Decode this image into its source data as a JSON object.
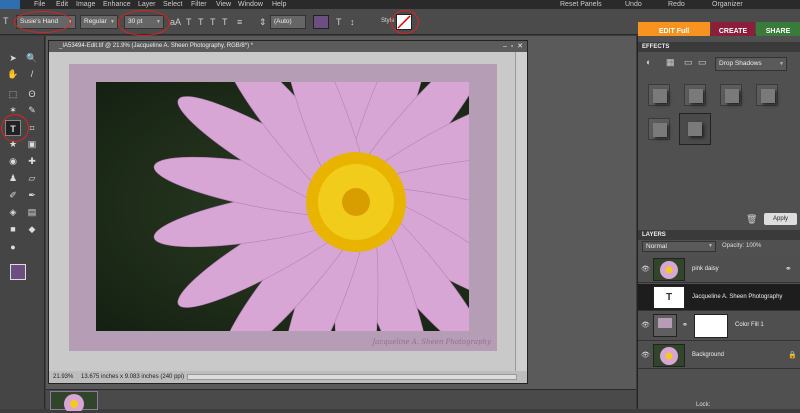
{
  "menubar": {
    "items": [
      "File",
      "Edit",
      "Image",
      "Enhance",
      "Layer",
      "Select",
      "Filter",
      "View",
      "Window",
      "Help"
    ],
    "reset_panels": "Reset Panels",
    "undo": "Undo",
    "redo": "Redo",
    "organizer": "Organizer"
  },
  "options": {
    "font_family": "Susie's Hand",
    "font_style": "Regular",
    "font_size": "30 pt",
    "leading": "(Auto)",
    "style_label": "Style",
    "text_color": "#6b4f80"
  },
  "mode_tabs": {
    "edit": "EDIT Full",
    "create": "CREATE",
    "share": "SHARE"
  },
  "document": {
    "title": "_IA53494-Edit.tif @ 21.9% (Jacqueline A. Sheen Photography, RGB/8*) *",
    "zoom": "21.93%",
    "dimensions": "13.675 inches x 9.083 inches (240 ppi)",
    "signature": "Jacqueline A. Sheen Photography"
  },
  "effects": {
    "title": "EFFECTS",
    "category": "Drop Shadows",
    "apply": "Apply"
  },
  "layers": {
    "title": "LAYERS",
    "blend_mode": "Normal",
    "opacity_label": "Opacity:",
    "opacity_value": "100%",
    "items": [
      {
        "name": "pink daisy"
      },
      {
        "name": "Jacqueline A. Sheen Photography"
      },
      {
        "name": "Color Fill 1"
      },
      {
        "name": "Background"
      }
    ],
    "lock_label": "Lock:"
  },
  "colors": {
    "foreground": "#6b4f80",
    "background": "#c05050",
    "accent_edit": "#f7931e",
    "accent_create": "#8b1f3b",
    "accent_share": "#3a7a3a"
  }
}
